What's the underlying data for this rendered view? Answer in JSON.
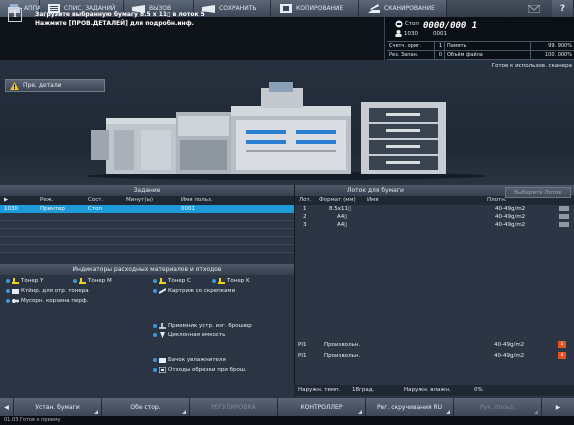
{
  "tabs": [
    {
      "label": "АППАРАТ",
      "icon": "machine-icon"
    },
    {
      "label": "СПИС. ЗАДАНИЙ",
      "icon": "job-list-icon"
    },
    {
      "label": "ВЫЗОВ",
      "icon": "recall-icon"
    },
    {
      "label": "СОХРАНИТЬ",
      "icon": "save-icon"
    },
    {
      "label": "КОПИРОВАНИЕ",
      "icon": "copy-icon"
    },
    {
      "label": "СКАНИРОВАНИЕ",
      "icon": "scan-icon"
    },
    {
      "label": "",
      "icon": "mail-icon"
    },
    {
      "label": "?",
      "icon": "help-icon"
    }
  ],
  "message": {
    "line1": "Загрузите выбранную бумагу 8.5 x 11▯  в лоток 5",
    "line2": "Нажмите [ПРОВ.ДЕТАЛЕЙ] для подробн.инф."
  },
  "counter": {
    "stop_label": "Стоп",
    "copies": "0000/000 1",
    "job_no": "1030",
    "job_sub": "0001",
    "rows": [
      [
        "Счетч. ориг.",
        "1",
        "Память",
        "99. 900%"
      ],
      [
        "Рез. Запан.",
        "0",
        "Объём файла",
        "100. 000%"
      ]
    ],
    "status": "Готов к использов. сканера"
  },
  "warning_button": "Пре. детали",
  "job_panel": {
    "title": "Задание",
    "columns": [
      "▶",
      "Реж.",
      "Сост.",
      "Минут(ы)",
      "Имя польз."
    ],
    "rows": [
      {
        "no": "1030",
        "mode": "Принтер",
        "state": "Стоп",
        "min": "",
        "user": "0001"
      }
    ]
  },
  "consumables": {
    "title": "Индикаторы расходных материалов и отходов",
    "items": [
      "Тонер Y",
      "Тонер M",
      "Тонер C",
      "Тонер K",
      "Ктйнр. для отр. тонера",
      "Картриж со скрепками",
      "Мусорн. корзина перф.",
      "Приемник устр. изг. брошюр",
      "Циклонная емкость",
      "Бачок увлажнителя",
      "Отходы обрезки при брош."
    ]
  },
  "tray_panel": {
    "title": "Лоток для бумаги",
    "select_button": "Выберите Лоток",
    "columns": [
      "Лот.",
      "Формат (мм)",
      "Имя",
      "Плотн."
    ],
    "rows": [
      {
        "tray": "1",
        "format": "8.5x11▯",
        "name": "",
        "weight": "40-49g/m2",
        "sel": true,
        "warn": false
      },
      {
        "tray": "2",
        "format": "A4▯",
        "name": "",
        "weight": "40-49g/m2",
        "sel": false,
        "warn": false
      },
      {
        "tray": "3",
        "format": "A4▯",
        "name": "",
        "weight": "40-49g/m2",
        "sel": false,
        "warn": false
      },
      {
        "tray": "PI1",
        "format": "Произвольн.",
        "name": "",
        "weight": "40-49g/m2",
        "sel": false,
        "warn": true
      },
      {
        "tray": "PI1",
        "format": "Произвольн.",
        "name": "",
        "weight": "40-49g/m2",
        "sel": false,
        "warn": true
      }
    ],
    "env": {
      "temp_label": "Наружн. темп.",
      "temp_value": "18град.",
      "hum_label": "Наружн. влажн.",
      "hum_value": "0%"
    }
  },
  "bottom": [
    "Устан. бумаги",
    "Обе стор.",
    "РЕГУЛИРОВКА",
    "КОНТРОЛЛЕР",
    "Рег. скручивания RU",
    "Рук. польз."
  ],
  "footer": "01.03  Готов к приему"
}
